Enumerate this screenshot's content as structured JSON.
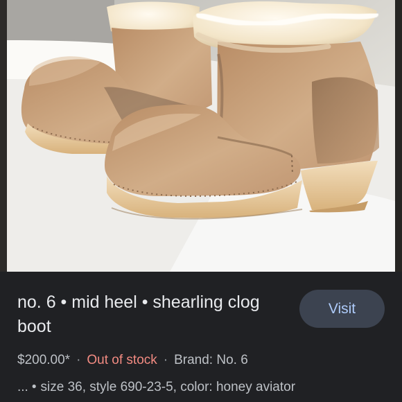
{
  "image": {
    "alt": "no. 6 mid heel shearling clog boot"
  },
  "product": {
    "title": "no. 6 • mid heel • shearling clog boot",
    "price": "$200.00*",
    "separator": "·",
    "stock_status": "Out of stock",
    "brand": "Brand: No. 6",
    "ellipsis": "...",
    "bullet": "•",
    "details": "size 36, style 690-23-5, color: honey aviator"
  },
  "actions": {
    "visit_label": "Visit"
  },
  "colors": {
    "background": "#202124",
    "title": "#e8eaed",
    "secondary_text": "#bdc1c6",
    "out_of_stock": "#f28b82",
    "button_bg": "#3c4350",
    "button_text": "#aecbfa"
  }
}
